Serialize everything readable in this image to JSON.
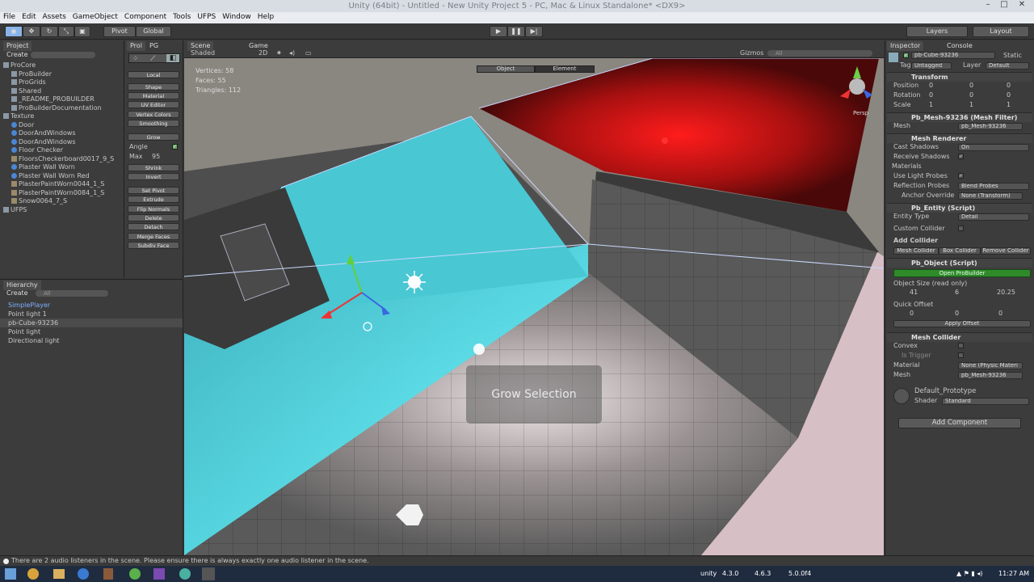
{
  "window": {
    "title": "Unity (64bit) - Untitled - New Unity Project 5 - PC, Mac & Linux Standalone* <DX9>"
  },
  "menu": [
    "File",
    "Edit",
    "Assets",
    "GameObject",
    "Component",
    "Tools",
    "UFPS",
    "Window",
    "Help"
  ],
  "toolbar": {
    "pivot": "Pivot",
    "global": "Global",
    "layers": "Layers",
    "layout": "Layout"
  },
  "project": {
    "tab": "Project",
    "create": "Create",
    "tree": [
      {
        "label": "ProCore",
        "kind": "folder"
      },
      {
        "label": "ProBuilder",
        "kind": "folder"
      },
      {
        "label": "ProGrids",
        "kind": "folder"
      },
      {
        "label": "Shared",
        "kind": "folder"
      },
      {
        "label": "_README_PROBUILDER",
        "kind": "doc"
      },
      {
        "label": "ProBuilderDocumentation",
        "kind": "doc"
      },
      {
        "label": "Texture",
        "kind": "folder"
      },
      {
        "label": "Door",
        "kind": "sphere"
      },
      {
        "label": "DoorAndWindows",
        "kind": "sphere"
      },
      {
        "label": "DoorAndWindows",
        "kind": "sphere"
      },
      {
        "label": "Floor Checker",
        "kind": "sphere"
      },
      {
        "label": "FloorsCheckerboard0017_9_S",
        "kind": "tex"
      },
      {
        "label": "Plaster Wall Worn",
        "kind": "sphere"
      },
      {
        "label": "Plaster Wall Worn Red",
        "kind": "sphere"
      },
      {
        "label": "PlasterPaintWorn0044_1_S",
        "kind": "tex"
      },
      {
        "label": "PlasterPaintWorn0084_1_S",
        "kind": "tex"
      },
      {
        "label": "Snow0064_7_S",
        "kind": "tex"
      },
      {
        "label": "UFPS",
        "kind": "folder"
      }
    ]
  },
  "probuilder": {
    "tabs": [
      "Prol",
      "PG"
    ],
    "local": "Local",
    "buttons1": [
      "Shape",
      "Material",
      "UV Editor",
      "Vertex Colors",
      "Smoothing"
    ],
    "grow": "Grow",
    "angle_label": "Angle",
    "max_label": "Max",
    "max_value": "95",
    "buttons2": [
      "Shrink",
      "Invert"
    ],
    "buttons3": [
      "Set Pivot",
      "Extrude",
      "Flip Normals",
      "Delete",
      "Detach",
      "Merge Faces",
      "Subdiv Face"
    ]
  },
  "hierarchy": {
    "tab": "Hierarchy",
    "create": "Create",
    "search_placeholder": "All",
    "items": [
      "SimplePlayer",
      "Point light 1",
      "pb-Cube-93236",
      "Point light",
      "Directional light"
    ]
  },
  "scene": {
    "tab_scene": "Scene",
    "tab_game": "Game",
    "shading": "Shaded",
    "mode_2d": "2D",
    "gizmos": "Gizmos",
    "search_placeholder": "All",
    "stats": {
      "vertices": "Vertices: 58",
      "faces": "Faces: 55",
      "triangles": "Triangles: 112"
    },
    "mode_object": "Object",
    "mode_element": "Element",
    "persp": "Persp",
    "toast": "Grow Selection"
  },
  "inspector": {
    "tab": "Inspector",
    "tab2": "Console",
    "object_name": "pb-Cube-93236",
    "static": "Static",
    "tag_label": "Tag",
    "tag_value": "Untagged",
    "layer_label": "Layer",
    "layer_value": "Default",
    "transform": {
      "title": "Transform",
      "rows": [
        {
          "label": "Position",
          "x": "0",
          "y": "0",
          "z": "0"
        },
        {
          "label": "Rotation",
          "x": "0",
          "y": "0",
          "z": "0"
        },
        {
          "label": "Scale",
          "x": "1",
          "y": "1",
          "z": "1"
        }
      ]
    },
    "mesh_filter": {
      "title": "Pb_Mesh-93236 (Mesh Filter)",
      "mesh_label": "Mesh",
      "mesh_value": "pb_Mesh-93236"
    },
    "mesh_renderer": {
      "title": "Mesh Renderer",
      "cast_shadows": "Cast Shadows",
      "cast_value": "On",
      "receive_shadows": "Receive Shadows",
      "materials": "Materials",
      "use_light_probes": "Use Light Probes",
      "reflection_probes": "Reflection Probes",
      "reflection_value": "Blend Probes",
      "anchor_override": "Anchor Override",
      "anchor_value": "None (Transform)"
    },
    "entity": {
      "title": "Pb_Entity (Script)",
      "entity_type": "Entity Type",
      "entity_value": "Detail",
      "custom_collider": "Custom Collider",
      "add_collider": "Add Collider",
      "buttons": [
        "Mesh Collider",
        "Box Collider",
        "Remove Collider"
      ]
    },
    "pb_object": {
      "title": "Pb_Object (Script)",
      "open": "Open ProBuilder",
      "object_size": "Object Size (read only)",
      "size": {
        "x": "41",
        "y": "6",
        "z": "20.25"
      },
      "quick_offset": "Quick Offset",
      "offset": {
        "x": "0",
        "y": "0",
        "z": "0"
      },
      "apply": "Apply Offset"
    },
    "mesh_collider": {
      "title": "Mesh Collider",
      "convex": "Convex",
      "is_trigger": "Is Trigger",
      "material": "Material",
      "material_value": "None (Physic Materi",
      "mesh": "Mesh",
      "mesh_value": "pb_Mesh-93236"
    },
    "material": {
      "name": "Default_Prototype",
      "shader_label": "Shader",
      "shader_value": "Standard"
    },
    "add_component": "Add Component"
  },
  "status": "There are 2 audio listeners in the scene. Please ensure there is always exactly one audio listener in the scene.",
  "taskbar": {
    "unity_label": "unity",
    "v1": "4.3.0",
    "v2": "4.6.3",
    "v3": "5.0.0f4",
    "clock": "11:27 AM"
  },
  "colors": {
    "selection_cyan": "#3fd4e0",
    "red_light": "#ff2a2a",
    "open_probuilder": "#2a8a2a",
    "taskbar": "#1f2c40"
  }
}
